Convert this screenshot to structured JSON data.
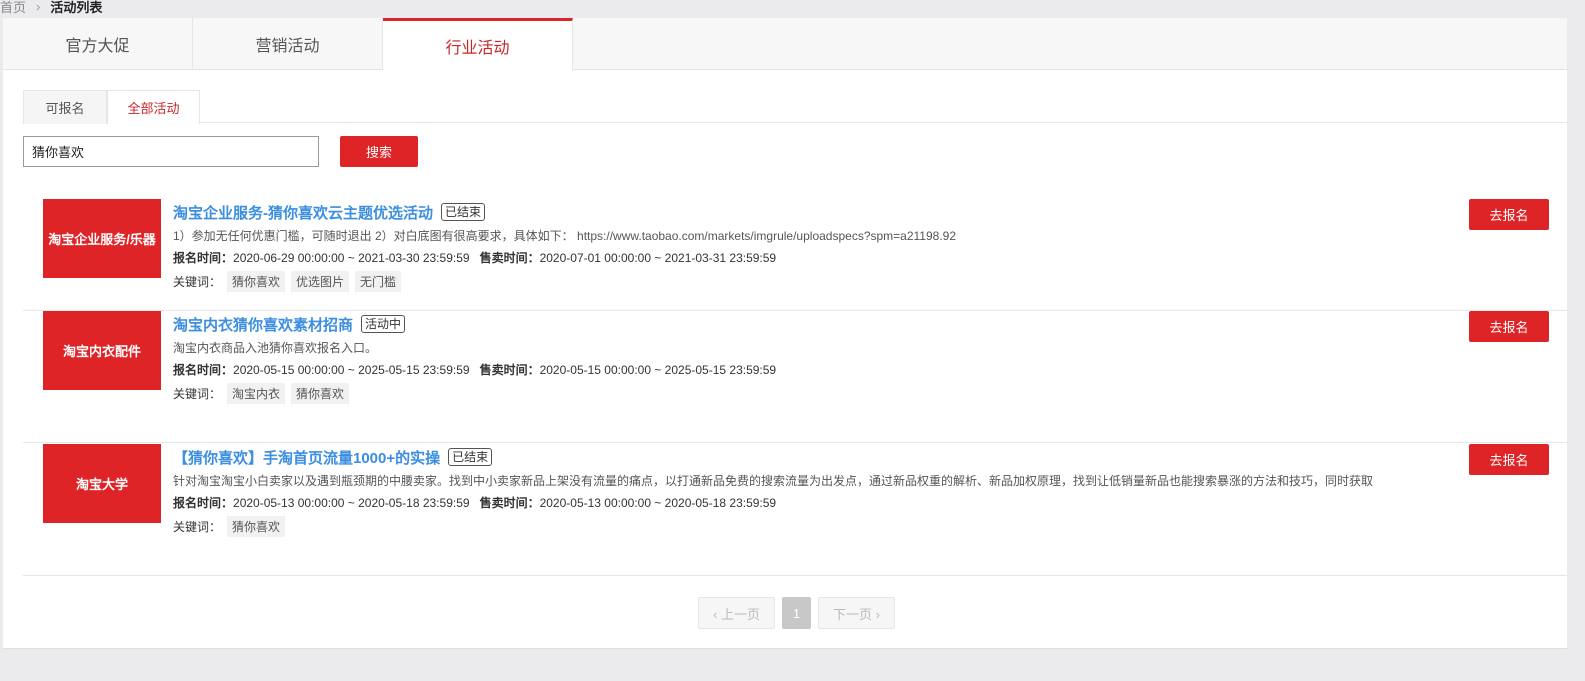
{
  "breadcrumb": {
    "home": "首页",
    "current": "活动列表"
  },
  "tabs": [
    "官方大促",
    "营销活动",
    "行业活动"
  ],
  "subtabs": [
    "可报名",
    "全部活动"
  ],
  "search": {
    "value": "猜你喜欢",
    "button": "搜索"
  },
  "labels": {
    "signup_time": "报名时间：",
    "sale_time": "售卖时间：",
    "keywords": "关键词：",
    "go": "去报名"
  },
  "items": [
    {
      "image_text": "淘宝企业服务/乐器",
      "title": "淘宝企业服务-猜你喜欢云主题优选活动",
      "status": "已结束",
      "desc": "1）参加无任何优惠门槛，可随时退出 2）对白底图有很高要求，具体如下： https://www.taobao.com/markets/imgrule/uploadspecs?spm=a21198.92",
      "signup": "2020-06-29 00:00:00 ~ 2021-03-30 23:59:59",
      "sale": "2020-07-01 00:00:00 ~ 2021-03-31 23:59:59",
      "tags": [
        "猜你喜欢",
        "优选图片",
        "无门槛"
      ]
    },
    {
      "image_text": "淘宝内衣配件",
      "title": "淘宝内衣猜你喜欢素材招商",
      "status": "活动中",
      "desc": "淘宝内衣商品入池猜你喜欢报名入口。",
      "signup": "2020-05-15 00:00:00 ~ 2025-05-15 23:59:59",
      "sale": "2020-05-15 00:00:00 ~ 2025-05-15 23:59:59",
      "tags": [
        "淘宝内衣",
        "猜你喜欢"
      ]
    },
    {
      "image_text": "淘宝大学",
      "title": "【猜你喜欢】手淘首页流量1000+的实操",
      "status": "已结束",
      "desc": "针对淘宝淘宝小白卖家以及遇到瓶颈期的中腰卖家。找到中小卖家新品上架没有流量的痛点，以打通新品免费的搜索流量为出发点，通过新品权重的解析、新品加权原理，找到让低销量新品也能搜索暴涨的方法和技巧，同时获取",
      "signup": "2020-05-13 00:00:00 ~ 2020-05-18 23:59:59",
      "sale": "2020-05-13 00:00:00 ~ 2020-05-18 23:59:59",
      "tags": [
        "猜你喜欢"
      ]
    }
  ],
  "pagination": {
    "prev": "‹ 上一页",
    "current": "1",
    "next": "下一页 ›"
  }
}
